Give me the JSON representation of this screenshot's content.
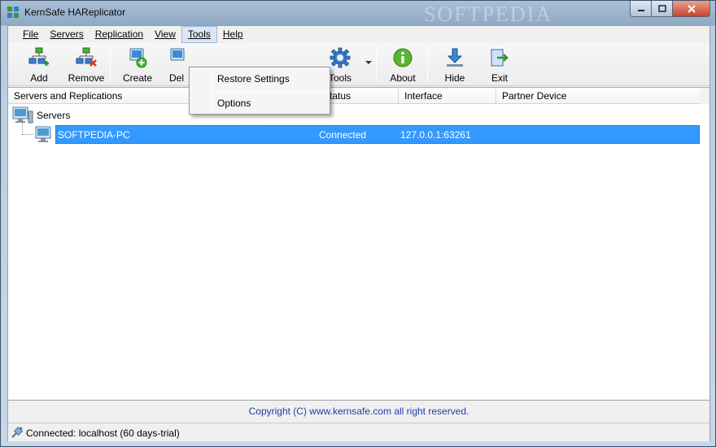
{
  "window": {
    "title": "KernSafe HAReplicator",
    "watermark": "SOFTPEDIA"
  },
  "menubar": [
    {
      "label": "File"
    },
    {
      "label": "Servers"
    },
    {
      "label": "Replication"
    },
    {
      "label": "View"
    },
    {
      "label": "Tools"
    },
    {
      "label": "Help"
    }
  ],
  "toolbar": {
    "add": "Add",
    "remove": "Remove",
    "create": "Create",
    "delete": "Del",
    "tools": "Tools",
    "about": "About",
    "hide": "Hide",
    "exit": "Exit"
  },
  "tools_menu": {
    "items": [
      "Restore Settings",
      "Options"
    ]
  },
  "listview": {
    "columns": [
      "Servers and Replications",
      "Status",
      "Interface",
      "Partner Device"
    ],
    "root": "Servers",
    "rows": [
      {
        "name": "SOFTPEDIA-PC",
        "status": "Connected",
        "interface": "127.0.0.1:63261",
        "partner": ""
      }
    ]
  },
  "footer": {
    "copyright": "Copyright (C) www.kernsafe.com all right reserved."
  },
  "status": {
    "text": "Connected: localhost (60 days-trial)"
  },
  "colors": {
    "selection": "#3399ff",
    "link": "#1c3fa6"
  }
}
